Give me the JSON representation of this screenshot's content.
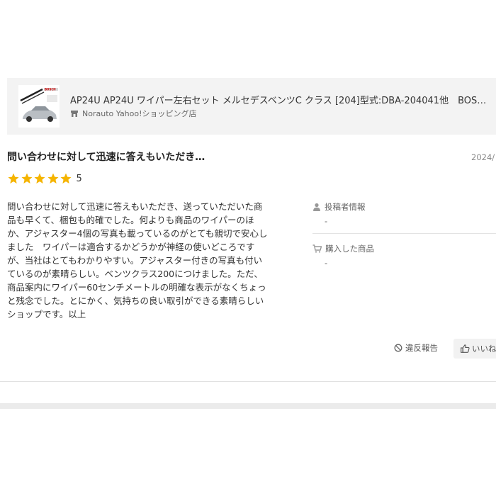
{
  "product": {
    "title": "AP24U AP24U ワイパー左右セット メルセデスベンツC クラス [204]型式:DBA-204041他　BOS…",
    "store": "Norauto Yahoo!ショッピング店",
    "store_icon": "store-icon",
    "thumbnail_brand": "BOSCH"
  },
  "review": {
    "title": "問い合わせに対して迅速に答えもいただき…",
    "date": "2024/",
    "rating": 5,
    "rating_label": "5",
    "body_lines": [
      "問い合わせに対して迅速に答えもいただき、送っていただいた商",
      "品も早くて、梱包も的確でした。何よりも商品のワイパーのほ",
      "か、アジャスター4個の写真も載っているのがとても親切で安心し",
      "ました　ワイパーは適合するかどうかが神経の使いどころです",
      "が、当社はとてもわかりやすい。アジャスター付きの写真も付い",
      "ているのが素晴らしい。ベンツクラス200につけました。ただ、",
      "商品案内にワイパー60センチメートルの明確な表示がなくちょっ",
      "と残念でした。とにかく、気持ちの良い取引ができる素晴らしい",
      "ショップです。以上"
    ]
  },
  "sidebar": {
    "poster_label": "投稿者情報",
    "poster_value": "-",
    "purchased_label": "購入した商品",
    "purchased_value": "-"
  },
  "actions": {
    "report_label": "違反報告",
    "like_label": "いいね"
  },
  "colors": {
    "star": "#f5b400",
    "card_bg": "#f3f3f3"
  }
}
